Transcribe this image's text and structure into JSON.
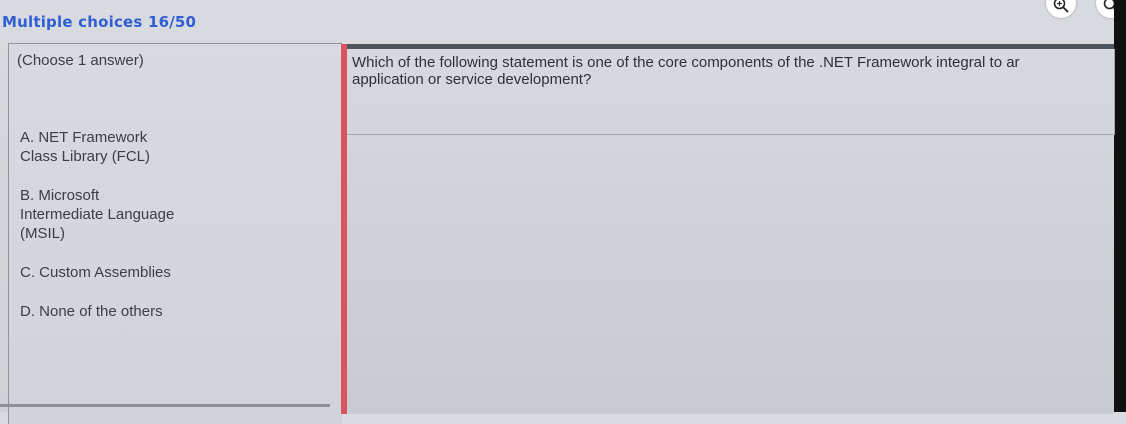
{
  "header": {
    "title": "Multiple choices 16/50"
  },
  "top_icons": [
    "zoom-in-icon",
    "search-icon"
  ],
  "left": {
    "instruction": "(Choose 1 answer)",
    "options": [
      {
        "lines": [
          "A. NET Framework",
          "Class Library (FCL)"
        ]
      },
      {
        "lines": [
          "B. Microsoft",
          "Intermediate Language",
          "(MSIL)"
        ]
      },
      {
        "lines": [
          "C. Custom Assemblies"
        ]
      },
      {
        "lines": [
          "D. None of the others"
        ]
      }
    ]
  },
  "question": {
    "lines": [
      "Which of the following statement is one of the core components of the .NET Framework integral to ar",
      "application or service development?"
    ]
  },
  "colors": {
    "title": "#2f5fd2",
    "divider": "#d95360",
    "panel_top": "#4f565f"
  }
}
